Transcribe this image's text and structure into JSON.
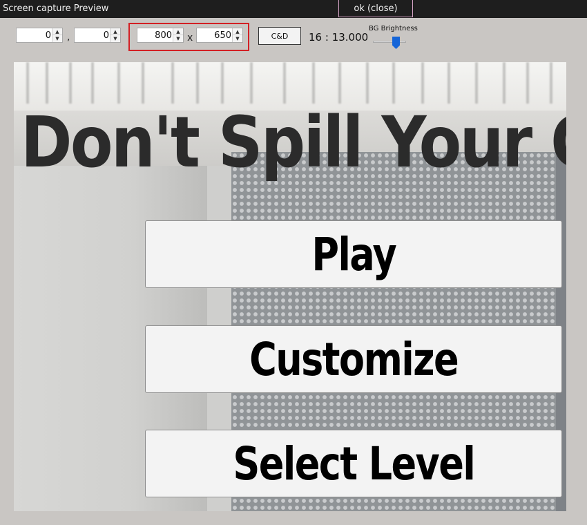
{
  "window": {
    "title": "Screen capture Preview",
    "ok_button": "ok (close)"
  },
  "toolbar": {
    "pos_x": "0",
    "pos_y": "0",
    "comma": ",",
    "width": "800",
    "height": "650",
    "times": "x",
    "cd_button": "C&D",
    "ratio": "16 : 13.000",
    "bg_brightness_label": "BG Brightness",
    "bg_brightness_value": 0.75,
    "accent_color": "#1565d8",
    "highlight_color": "#d32024"
  },
  "game": {
    "title": "Don't Spill Your Coffee",
    "buttons": [
      "Play",
      "Customize",
      "Select Level"
    ]
  }
}
